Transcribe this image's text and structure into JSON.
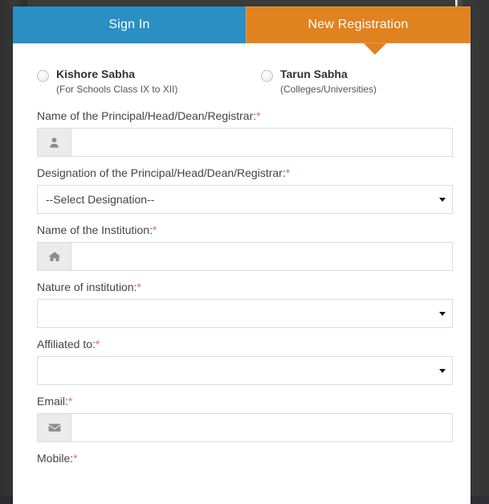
{
  "tabs": [
    {
      "label": "Sign In",
      "name": "tab-sign-in",
      "active": false
    },
    {
      "label": "New Registration",
      "name": "tab-new-registration",
      "active": true
    }
  ],
  "colors": {
    "tab_signin_bg": "#2a8fc4",
    "tab_register_bg": "#e0821f",
    "required_asterisk": "#e8637c",
    "page_backdrop": "#3b3b3b",
    "addon_bg": "#ebebeb",
    "field_border": "#dcdcdc"
  },
  "radio_group": {
    "options": [
      {
        "title": "Kishore Sabha",
        "subtitle": "(For Schools Class IX to XII)",
        "selected": false
      },
      {
        "title": "Tarun Sabha",
        "subtitle": "(Colleges/Universities)",
        "selected": false
      }
    ]
  },
  "fields": {
    "principal_name": {
      "label": "Name of the Principal/Head/Dean/Registrar:",
      "required": "*",
      "icon": "user-icon",
      "value": "",
      "placeholder": ""
    },
    "designation": {
      "label": "Designation of the Principal/Head/Dean/Registrar:",
      "required": "*",
      "selected": "--Select Designation--"
    },
    "institution_name": {
      "label": "Name of the Institution:",
      "required": "*",
      "icon": "home-icon",
      "value": "",
      "placeholder": ""
    },
    "nature_of_institution": {
      "label": "Nature of institution:",
      "required": "*",
      "selected": ""
    },
    "affiliated_to": {
      "label": "Affiliated to:",
      "required": "*",
      "selected": ""
    },
    "email": {
      "label": "Email:",
      "required": "*",
      "icon": "envelope-icon",
      "value": "",
      "placeholder": ""
    },
    "mobile": {
      "label": "Mobile:",
      "required": "*"
    }
  }
}
